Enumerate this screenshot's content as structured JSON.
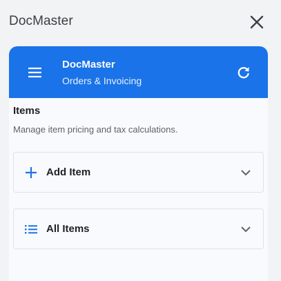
{
  "app": {
    "name": "DocMaster"
  },
  "header": {
    "title": "DocMaster",
    "subtitle": "Orders & Invoicing"
  },
  "section": {
    "title": "Items",
    "description": "Manage item pricing and tax calculations."
  },
  "cards": [
    {
      "label": "Add Item",
      "icon": "plus-icon"
    },
    {
      "label": "All Items",
      "icon": "list-icon"
    }
  ],
  "colors": {
    "accent": "#1a73e8",
    "panel_bg": "#f8fafd",
    "page_bg": "#f1f3f4"
  }
}
